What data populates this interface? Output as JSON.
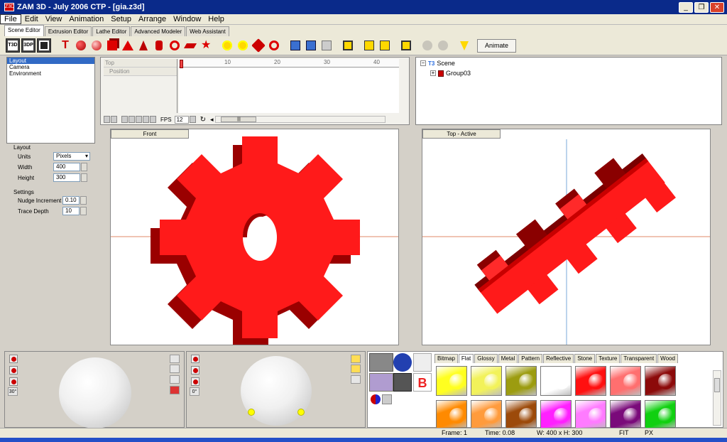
{
  "window": {
    "title": "ZAM 3D - July 2006 CTP - [gia.z3d]",
    "app_icon": "Z3D"
  },
  "menu": [
    "File",
    "Edit",
    "View",
    "Animation",
    "Setup",
    "Arrange",
    "Window",
    "Help"
  ],
  "editor_tabs": [
    "Scene Editor",
    "Extrusion Editor",
    "Lathe Editor",
    "Advanced Modeler",
    "Web Assistant"
  ],
  "toolbar": {
    "animate_label": "Animate"
  },
  "layout_list": [
    "Layout",
    "Camera",
    "Environment"
  ],
  "properties": {
    "layout_header": "Layout",
    "units_label": "Units",
    "units_value": "Pixels",
    "width_label": "Width",
    "width_value": "400",
    "height_label": "Height",
    "height_value": "300",
    "settings_header": "Settings",
    "nudge_label": "Nudge Increment",
    "nudge_value": "0.10",
    "trace_label": "Trace Depth",
    "trace_value": "10"
  },
  "timeline": {
    "rows": [
      "Top",
      "Position"
    ],
    "ticks": [
      "10",
      "20",
      "30",
      "40"
    ],
    "fps_label": "FPS",
    "fps_value": "12",
    "scroll_glyph": "|||"
  },
  "scene_tree": {
    "root": "Scene",
    "child": "Group03"
  },
  "viewports": {
    "front_label": "Front",
    "top_label": "Top - Active"
  },
  "material_tabs": [
    "Bitmap",
    "Flat",
    "Glossy",
    "Metal",
    "Pattern",
    "Reflective",
    "Stone",
    "Texture",
    "Transparent",
    "Wood"
  ],
  "lighting": {
    "left_angle": "30°",
    "right_angle": "0°"
  },
  "swatch_colors": {
    "row1": [
      "#ffff20",
      "#f2f25a",
      "#9c9c10",
      "#ffffff",
      "#ff1010",
      "#ff6f6f",
      "#8c0a0a"
    ],
    "row2": [
      "#ff8a00",
      "#ff9b3c",
      "#9c4a0a",
      "#ff20ff",
      "#ff7bff",
      "#7a0a7a",
      "#10d010"
    ]
  },
  "status": {
    "frame": "Frame: 1",
    "time": "Time: 0.08",
    "size": "W: 400 x H: 300",
    "fit": "FIT",
    "unit": "PX"
  },
  "colors": {
    "gear": "#ff1a1a",
    "gear_side": "#a00000",
    "selection": "#316ac5",
    "title_bar": "#0a2a8a"
  }
}
